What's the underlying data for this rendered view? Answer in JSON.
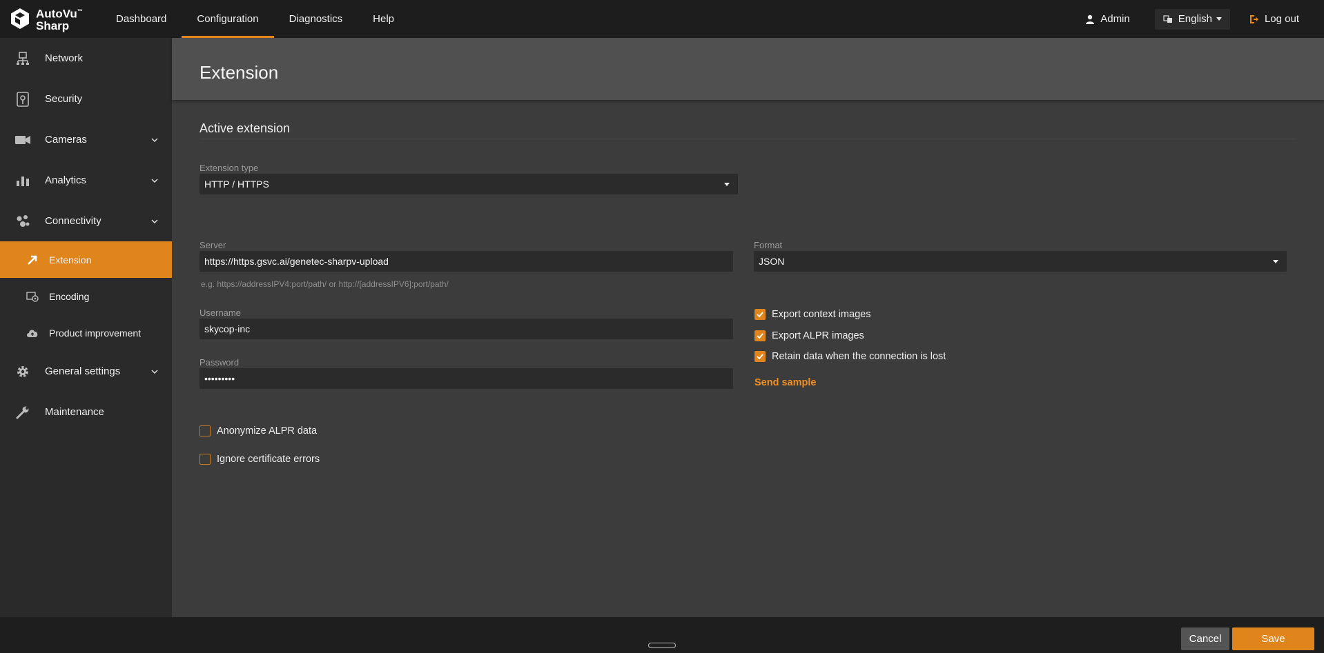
{
  "app": {
    "brand_line1": "AutoVu",
    "brand_line2": "Sharp",
    "brand_tm": "™"
  },
  "nav": [
    {
      "label": "Dashboard"
    },
    {
      "label": "Configuration"
    },
    {
      "label": "Diagnostics"
    },
    {
      "label": "Help"
    }
  ],
  "top_right": {
    "user": "Admin",
    "language": "English",
    "logout": "Log out"
  },
  "sidebar": {
    "items": [
      {
        "label": "Network",
        "icon": "network-icon"
      },
      {
        "label": "Security",
        "icon": "security-icon"
      },
      {
        "label": "Cameras",
        "icon": "camera-icon"
      },
      {
        "label": "Analytics",
        "icon": "analytics-icon"
      },
      {
        "label": "Connectivity",
        "icon": "connectivity-icon"
      }
    ],
    "subitems": [
      {
        "label": "Extension",
        "icon": "extension-icon"
      },
      {
        "label": "Encoding",
        "icon": "encoding-icon"
      },
      {
        "label": "Product improvement",
        "icon": "cloud-upload-icon"
      }
    ],
    "bottom_items": [
      {
        "label": "General settings",
        "icon": "gear-icon"
      },
      {
        "label": "Maintenance",
        "icon": "wrench-icon"
      }
    ]
  },
  "page": {
    "title": "Extension",
    "section_title": "Active extension",
    "extension_type": {
      "label": "Extension type",
      "value": "HTTP / HTTPS"
    },
    "server": {
      "label": "Server",
      "value": "https://https.gsvc.ai/genetec-sharpv-upload",
      "hint": "e.g. https://addressIPV4:port/path/ or http://[addressIPV6]:port/path/"
    },
    "format": {
      "label": "Format",
      "value": "JSON"
    },
    "username": {
      "label": "Username",
      "value": "skycop-inc"
    },
    "password": {
      "label": "Password",
      "value": "•••••••••"
    },
    "checkboxes_right": [
      {
        "label": "Export context images",
        "checked": true
      },
      {
        "label": "Export ALPR images",
        "checked": true
      },
      {
        "label": "Retain data when the connection is lost",
        "checked": true
      }
    ],
    "send_sample": "Send sample",
    "checkboxes_left": [
      {
        "label": "Anonymize ALPR data",
        "checked": false
      },
      {
        "label": "Ignore certificate errors",
        "checked": false
      }
    ]
  },
  "footer": {
    "cancel": "Cancel",
    "save": "Save"
  },
  "colors": {
    "accent": "#e0851c",
    "topbar": "#1d1d1d",
    "sidebar": "#2a2a2a",
    "content": "#3c3c3c",
    "field": "#2b2b2b"
  }
}
